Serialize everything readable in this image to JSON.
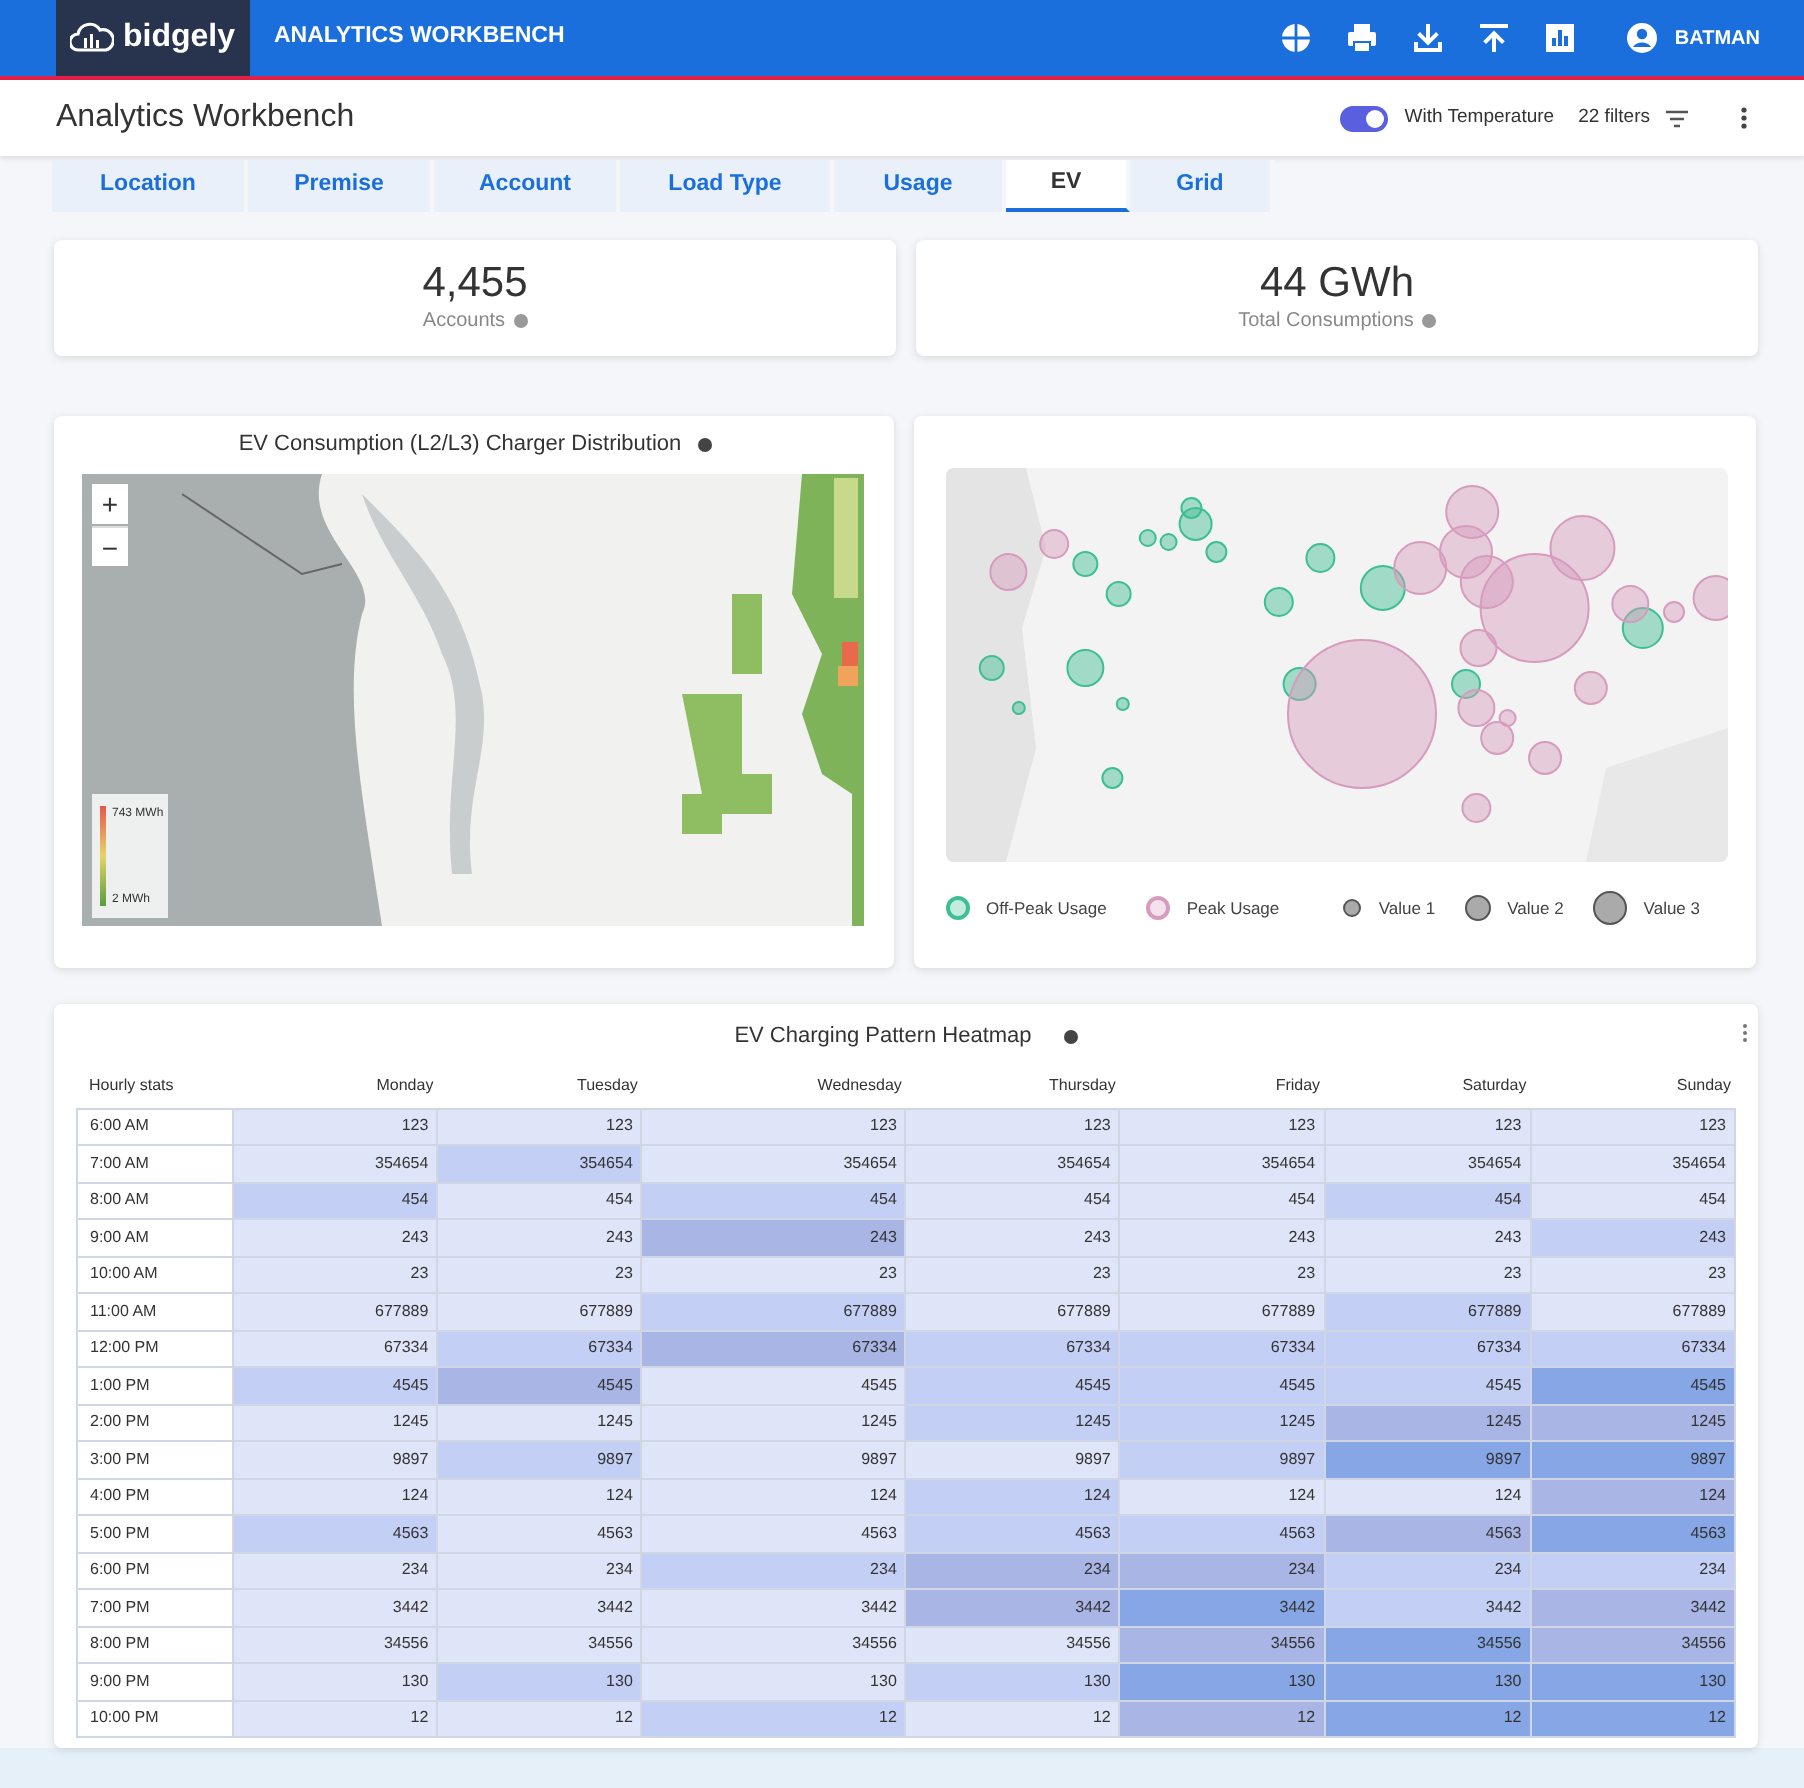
{
  "app": {
    "logo": "bidgely",
    "title": "ANALYTICS WORKBENCH",
    "user": "BATMAN"
  },
  "page": {
    "title": "Analytics Workbench",
    "toggle": {
      "label": "With Temperature",
      "on": true
    },
    "filters": "22 filters"
  },
  "tabs": [
    {
      "label": "Location",
      "selected": false
    },
    {
      "label": "Premise",
      "selected": false
    },
    {
      "label": "Account",
      "selected": false
    },
    {
      "label": "Load Type",
      "selected": false
    },
    {
      "label": "Usage",
      "selected": false
    },
    {
      "label": "EV",
      "selected": true
    },
    {
      "label": "Grid",
      "selected": false
    }
  ],
  "kpis": [
    {
      "value": "4,455",
      "label": "Accounts"
    },
    {
      "value": "44 GWh",
      "label": "Total Consumptions"
    }
  ],
  "distribution_map": {
    "title": "EV Consumption (L2/L3) Charger Distribution",
    "zoom_in": "+",
    "zoom_out": "−",
    "legend_max": "743 MWh",
    "legend_min": "2 MWh"
  },
  "bubble_map": {
    "legend": [
      {
        "label": "Off-Peak Usage",
        "kind": "series",
        "color": "#3dbf93"
      },
      {
        "label": "Peak Usage",
        "kind": "series",
        "color": "#d79bbd"
      },
      {
        "label": "Value 1",
        "kind": "size"
      },
      {
        "label": "Value 2",
        "kind": "size"
      },
      {
        "label": "Value 3",
        "kind": "size"
      }
    ]
  },
  "heatmap": {
    "title": "EV Charging Pattern Heatmap",
    "columns": [
      "Hourly stats",
      "Monday",
      "Tuesday",
      "Wednesday",
      "Thursday",
      "Friday",
      "Saturday",
      "Sunday"
    ],
    "rows": [
      {
        "cells": [
          {
            "value": "6:00 AM"
          },
          {
            "value": "123",
            "color": "#dfe5f8"
          },
          {
            "value": "123",
            "color": "#dfe5f8"
          },
          {
            "value": "123",
            "color": "#dfe5f8"
          },
          {
            "value": "123",
            "color": "#dfe5f8"
          },
          {
            "value": "123",
            "color": "#dfe5f8"
          },
          {
            "value": "123",
            "color": "#dfe5f8"
          },
          {
            "value": "123",
            "color": "#dfe5f8"
          }
        ]
      },
      {
        "cells": [
          {
            "value": "7:00 AM"
          },
          {
            "value": "354654",
            "color": "#dfe5f8"
          },
          {
            "value": "354654",
            "color": "#c4cff5"
          },
          {
            "value": "354654",
            "color": "#dfe5f8"
          },
          {
            "value": "354654",
            "color": "#dfe5f8"
          },
          {
            "value": "354654",
            "color": "#dfe5f8"
          },
          {
            "value": "354654",
            "color": "#dfe5f8"
          },
          {
            "value": "354654",
            "color": "#dfe5f8"
          }
        ]
      },
      {
        "cells": [
          {
            "value": "8:00 AM"
          },
          {
            "value": "454",
            "color": "#c4cff5"
          },
          {
            "value": "454",
            "color": "#dfe5f8"
          },
          {
            "value": "454",
            "color": "#c4cff5"
          },
          {
            "value": "454",
            "color": "#dfe5f8"
          },
          {
            "value": "454",
            "color": "#dfe5f8"
          },
          {
            "value": "454",
            "color": "#c4cff5"
          },
          {
            "value": "454",
            "color": "#dfe5f8"
          }
        ]
      },
      {
        "cells": [
          {
            "value": "9:00 AM"
          },
          {
            "value": "243",
            "color": "#dfe5f8"
          },
          {
            "value": "243",
            "color": "#dfe5f8"
          },
          {
            "value": "243",
            "color": "#a8b5e5"
          },
          {
            "value": "243",
            "color": "#dfe5f8"
          },
          {
            "value": "243",
            "color": "#dfe5f8"
          },
          {
            "value": "243",
            "color": "#dfe5f8"
          },
          {
            "value": "243",
            "color": "#c4cff5"
          }
        ]
      },
      {
        "cells": [
          {
            "value": "10:00 AM"
          },
          {
            "value": "23",
            "color": "#dfe5f8"
          },
          {
            "value": "23",
            "color": "#dfe5f8"
          },
          {
            "value": "23",
            "color": "#dfe5f8"
          },
          {
            "value": "23",
            "color": "#dfe5f8"
          },
          {
            "value": "23",
            "color": "#dfe5f8"
          },
          {
            "value": "23",
            "color": "#dfe5f8"
          },
          {
            "value": "23",
            "color": "#dfe5f8"
          }
        ]
      },
      {
        "cells": [
          {
            "value": "11:00 AM"
          },
          {
            "value": "677889",
            "color": "#dfe5f8"
          },
          {
            "value": "677889",
            "color": "#dfe5f8"
          },
          {
            "value": "677889",
            "color": "#c4cff5"
          },
          {
            "value": "677889",
            "color": "#dfe5f8"
          },
          {
            "value": "677889",
            "color": "#dfe5f8"
          },
          {
            "value": "677889",
            "color": "#c4cff5"
          },
          {
            "value": "677889",
            "color": "#dfe5f8"
          }
        ]
      },
      {
        "cells": [
          {
            "value": "12:00 PM"
          },
          {
            "value": "67334",
            "color": "#dfe5f8"
          },
          {
            "value": "67334",
            "color": "#c4cff5"
          },
          {
            "value": "67334",
            "color": "#a8b5e5"
          },
          {
            "value": "67334",
            "color": "#c4cff5"
          },
          {
            "value": "67334",
            "color": "#c4cff5"
          },
          {
            "value": "67334",
            "color": "#c4cff5"
          },
          {
            "value": "67334",
            "color": "#c4cff5"
          }
        ]
      },
      {
        "cells": [
          {
            "value": "1:00 PM"
          },
          {
            "value": "4545",
            "color": "#c4cff5"
          },
          {
            "value": "4545",
            "color": "#a8b5e5"
          },
          {
            "value": "4545",
            "color": "#dfe5f8"
          },
          {
            "value": "4545",
            "color": "#c4cff5"
          },
          {
            "value": "4545",
            "color": "#c4cff5"
          },
          {
            "value": "4545",
            "color": "#c4cff5"
          },
          {
            "value": "4545",
            "color": "#86a6e5"
          }
        ]
      },
      {
        "cells": [
          {
            "value": "2:00 PM"
          },
          {
            "value": "1245",
            "color": "#dfe5f8"
          },
          {
            "value": "1245",
            "color": "#dfe5f8"
          },
          {
            "value": "1245",
            "color": "#dfe5f8"
          },
          {
            "value": "1245",
            "color": "#c4cff5"
          },
          {
            "value": "1245",
            "color": "#c4cff5"
          },
          {
            "value": "1245",
            "color": "#a8b5e5"
          },
          {
            "value": "1245",
            "color": "#a8b5e5"
          }
        ]
      },
      {
        "cells": [
          {
            "value": "3:00 PM"
          },
          {
            "value": "9897",
            "color": "#dfe5f8"
          },
          {
            "value": "9897",
            "color": "#c4cff5"
          },
          {
            "value": "9897",
            "color": "#dfe5f8"
          },
          {
            "value": "9897",
            "color": "#dfe5f8"
          },
          {
            "value": "9897",
            "color": "#c4cff5"
          },
          {
            "value": "9897",
            "color": "#86a6e5"
          },
          {
            "value": "9897",
            "color": "#86a6e5"
          }
        ]
      },
      {
        "cells": [
          {
            "value": "4:00 PM"
          },
          {
            "value": "124",
            "color": "#dfe5f8"
          },
          {
            "value": "124",
            "color": "#dfe5f8"
          },
          {
            "value": "124",
            "color": "#dfe5f8"
          },
          {
            "value": "124",
            "color": "#c4cff5"
          },
          {
            "value": "124",
            "color": "#dfe5f8"
          },
          {
            "value": "124",
            "color": "#dfe5f8"
          },
          {
            "value": "124",
            "color": "#a8b5e5"
          }
        ]
      },
      {
        "cells": [
          {
            "value": "5:00 PM"
          },
          {
            "value": "4563",
            "color": "#c4cff5"
          },
          {
            "value": "4563",
            "color": "#dfe5f8"
          },
          {
            "value": "4563",
            "color": "#dfe5f8"
          },
          {
            "value": "4563",
            "color": "#c4cff5"
          },
          {
            "value": "4563",
            "color": "#c4cff5"
          },
          {
            "value": "4563",
            "color": "#a8b5e5"
          },
          {
            "value": "4563",
            "color": "#86a6e5"
          }
        ]
      },
      {
        "cells": [
          {
            "value": "6:00 PM"
          },
          {
            "value": "234",
            "color": "#dfe5f8"
          },
          {
            "value": "234",
            "color": "#dfe5f8"
          },
          {
            "value": "234",
            "color": "#c4cff5"
          },
          {
            "value": "234",
            "color": "#a8b5e5"
          },
          {
            "value": "234",
            "color": "#a8b5e5"
          },
          {
            "value": "234",
            "color": "#c4cff5"
          },
          {
            "value": "234",
            "color": "#c4cff5"
          }
        ]
      },
      {
        "cells": [
          {
            "value": "7:00 PM"
          },
          {
            "value": "3442",
            "color": "#dfe5f8"
          },
          {
            "value": "3442",
            "color": "#dfe5f8"
          },
          {
            "value": "3442",
            "color": "#dfe5f8"
          },
          {
            "value": "3442",
            "color": "#a8b5e5"
          },
          {
            "value": "3442",
            "color": "#86a6e5"
          },
          {
            "value": "3442",
            "color": "#c4cff5"
          },
          {
            "value": "3442",
            "color": "#a8b5e5"
          }
        ]
      },
      {
        "cells": [
          {
            "value": "8:00 PM"
          },
          {
            "value": "34556",
            "color": "#dfe5f8"
          },
          {
            "value": "34556",
            "color": "#dfe5f8"
          },
          {
            "value": "34556",
            "color": "#dfe5f8"
          },
          {
            "value": "34556",
            "color": "#dfe5f8"
          },
          {
            "value": "34556",
            "color": "#a8b5e5"
          },
          {
            "value": "34556",
            "color": "#86a6e5"
          },
          {
            "value": "34556",
            "color": "#a8b5e5"
          }
        ]
      },
      {
        "cells": [
          {
            "value": "9:00 PM"
          },
          {
            "value": "130",
            "color": "#dfe5f8"
          },
          {
            "value": "130",
            "color": "#c4cff5"
          },
          {
            "value": "130",
            "color": "#dfe5f8"
          },
          {
            "value": "130",
            "color": "#c4cff5"
          },
          {
            "value": "130",
            "color": "#86a6e5"
          },
          {
            "value": "130",
            "color": "#86a6e5"
          },
          {
            "value": "130",
            "color": "#86a6e5"
          }
        ]
      },
      {
        "cells": [
          {
            "value": "10:00 PM"
          },
          {
            "value": "12",
            "color": "#dfe5f8"
          },
          {
            "value": "12",
            "color": "#dfe5f8"
          },
          {
            "value": "12",
            "color": "#c4cff5"
          },
          {
            "value": "12",
            "color": "#dfe5f8"
          },
          {
            "value": "12",
            "color": "#a8b5e5"
          },
          {
            "value": "12",
            "color": "#86a6e5"
          },
          {
            "value": "12",
            "color": "#86a6e5"
          }
        ]
      }
    ]
  }
}
